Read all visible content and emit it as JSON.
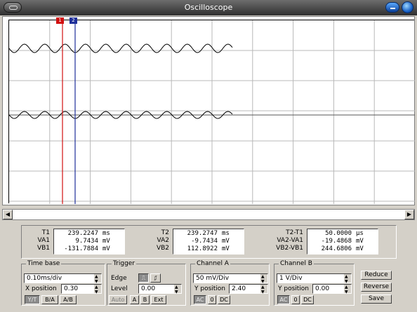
{
  "window": {
    "title": "Oscilloscope"
  },
  "cursors": {
    "c1_label": "1",
    "c2_label": "2"
  },
  "readout": {
    "col1": [
      {
        "label": "T1",
        "value": "239.2247",
        "unit": "ms"
      },
      {
        "label": "VA1",
        "value": "9.7434",
        "unit": "mV"
      },
      {
        "label": "VB1",
        "value": "-131.7884",
        "unit": "mV"
      }
    ],
    "col2": [
      {
        "label": "T2",
        "value": "239.2747",
        "unit": "ms"
      },
      {
        "label": "VA2",
        "value": "-9.7434",
        "unit": "mV"
      },
      {
        "label": "VB2",
        "value": "112.8922",
        "unit": "mV"
      }
    ],
    "col3": [
      {
        "label": "T2-T1",
        "value": "50.0000",
        "unit": "µs"
      },
      {
        "label": "VA2-VA1",
        "value": "-19.4868",
        "unit": "mV"
      },
      {
        "label": "VB2-VB1",
        "value": "244.6806",
        "unit": "mV"
      }
    ]
  },
  "timebase": {
    "title": "Time base",
    "value": "0.10ms/div",
    "xpos_label": "X position",
    "xpos_value": "0.30",
    "buttons": [
      "Y/T",
      "B/A",
      "A/B"
    ]
  },
  "trigger": {
    "title": "Trigger",
    "edge_label": "Edge",
    "level_label": "Level",
    "level_value": "0.00",
    "buttons": [
      "Auto",
      "A",
      "B",
      "Ext"
    ]
  },
  "channel_a": {
    "title": "Channel A",
    "value": "50 mV/Div",
    "ypos_label": "Y position",
    "ypos_value": "2.40",
    "buttons": [
      "AC",
      "0",
      "DC"
    ]
  },
  "channel_b": {
    "title": "Channel B",
    "value": "1  V/Div",
    "ypos_label": "Y position",
    "ypos_value": "0.00",
    "buttons": [
      "AC",
      "0",
      "DC"
    ]
  },
  "actions": {
    "reduce": "Reduce",
    "reverse": "Reverse",
    "save": "Save"
  },
  "colors": {
    "cursor1": "#d21010",
    "cursor2": "#1e2f9a",
    "grid": "#b8b8b8",
    "trace": "#000000"
  }
}
